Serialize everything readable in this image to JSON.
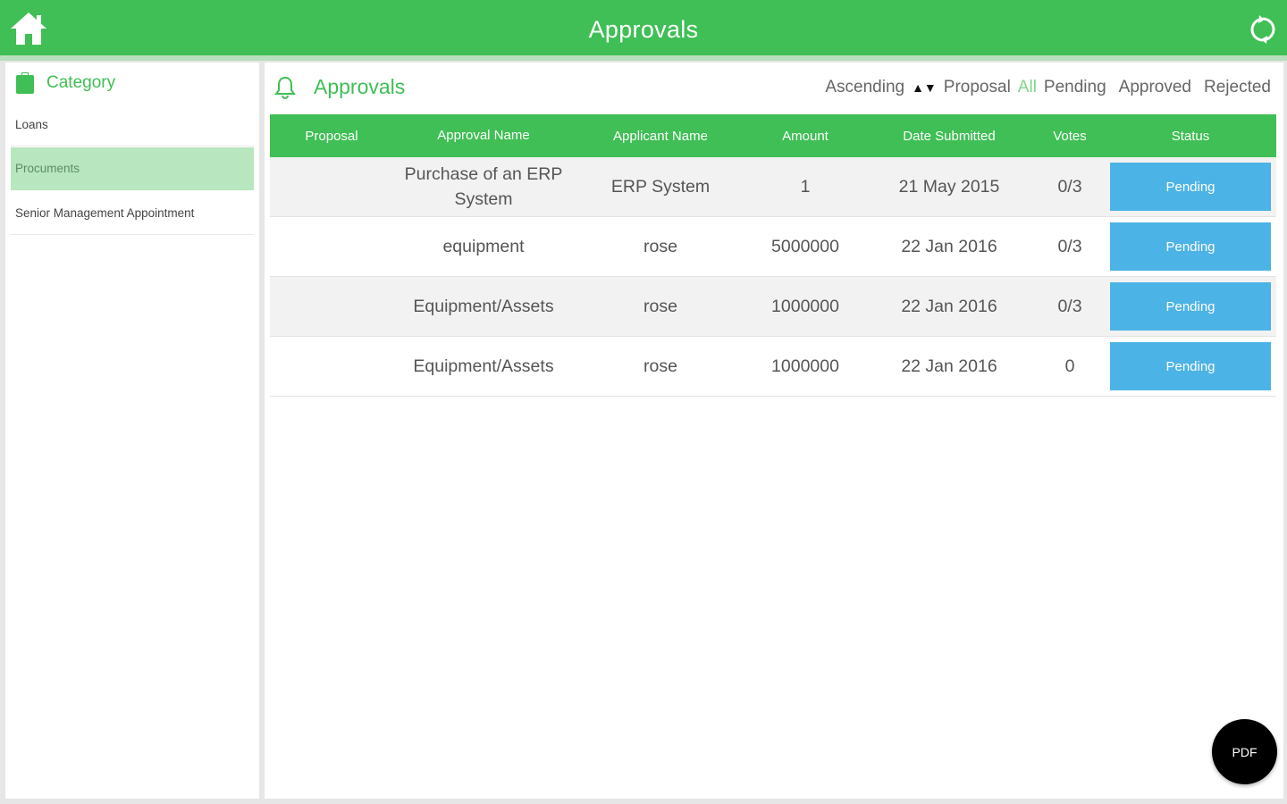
{
  "app": {
    "title": "Approvals"
  },
  "topbar": {
    "home_icon": "home-icon",
    "refresh_icon": "refresh-icon"
  },
  "sidebar": {
    "title": "Category",
    "items": [
      {
        "label": "Loans",
        "active": false
      },
      {
        "label": "Procuments",
        "active": true
      },
      {
        "label": "Senior Management Appointment",
        "active": false
      }
    ]
  },
  "main": {
    "title": "Approvals",
    "sort_label": "Ascending",
    "filters": {
      "proposal": "Proposal",
      "all": "All",
      "pending": "Pending",
      "approved": "Approved",
      "rejected": "Rejected"
    }
  },
  "table": {
    "columns": [
      "Proposal",
      "Approval Name",
      "Applicant Name",
      "Amount",
      "Date Submitted",
      "Votes",
      "Status"
    ],
    "rows": [
      {
        "proposal": "",
        "approval_name": "Purchase of an ERP System",
        "applicant": "ERP System",
        "amount": "1",
        "date": "21 May 2015",
        "votes": "0/3",
        "status": "Pending"
      },
      {
        "proposal": "",
        "approval_name": "equipment",
        "applicant": "rose",
        "amount": "5000000",
        "date": "22 Jan 2016",
        "votes": "0/3",
        "status": "Pending"
      },
      {
        "proposal": "",
        "approval_name": "Equipment/Assets",
        "applicant": "rose",
        "amount": "1000000",
        "date": "22 Jan 2016",
        "votes": "0/3",
        "status": "Pending"
      },
      {
        "proposal": "",
        "approval_name": "Equipment/Assets",
        "applicant": "rose",
        "amount": "1000000",
        "date": "22 Jan 2016",
        "votes": "0",
        "status": "Pending"
      }
    ]
  },
  "pdf_button": {
    "label": "PDF"
  },
  "colors": {
    "accent": "#3fbf55",
    "status_pending": "#4cb3e6",
    "active_item": "#b8e6bf"
  }
}
